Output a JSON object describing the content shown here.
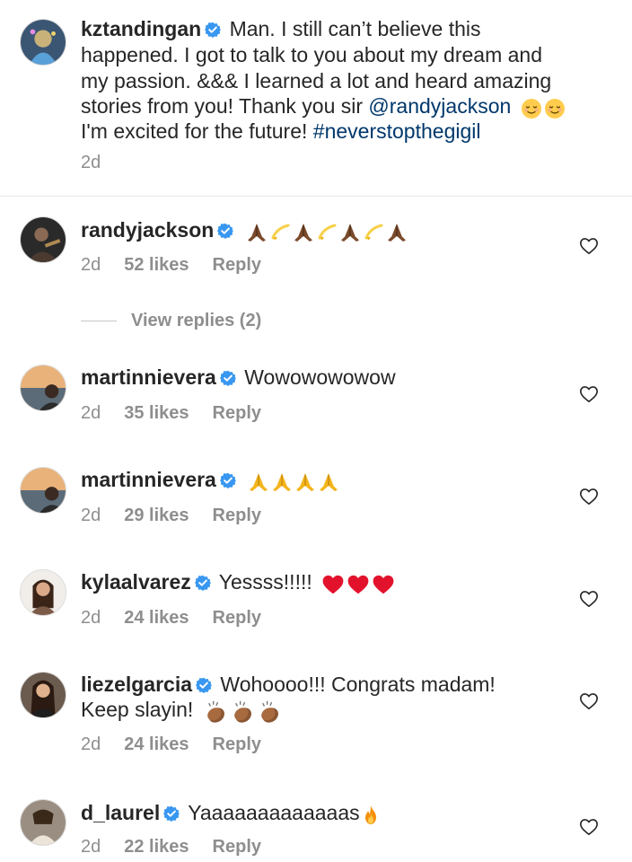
{
  "caption": {
    "username": "kztandingan",
    "lines": [
      "Man. I still can’t believe this",
      "happened. I got to talk to you about my dream and",
      "my passion. &&& I learned a lot and heard amazing",
      "stories from you! Thank you sir"
    ],
    "mention": "@randyjackson",
    "line5": "I'm excited for the future!",
    "hashtag": "#neverstopthegigil",
    "time": "2d",
    "emojis": [
      "relieved-face",
      "relieved-face"
    ]
  },
  "comments": [
    {
      "username": "randyjackson",
      "text": "",
      "emojis": [
        "pray-dark",
        "dizzy",
        "pray-dark",
        "dizzy",
        "pray-dark",
        "dizzy",
        "pray-dark"
      ],
      "time": "2d",
      "likes": "52 likes",
      "reply": "Reply"
    },
    {
      "username": "martinnievera",
      "text": "Wowowowowow",
      "emojis": [],
      "time": "2d",
      "likes": "35 likes",
      "reply": "Reply"
    },
    {
      "username": "martinnievera",
      "text": "",
      "emojis": [
        "pray",
        "pray",
        "pray",
        "pray"
      ],
      "time": "2d",
      "likes": "29 likes",
      "reply": "Reply"
    },
    {
      "username": "kylaalvarez",
      "text": "Yessss!!!!!",
      "emojis": [
        "heart-red",
        "heart-red",
        "heart-red"
      ],
      "time": "2d",
      "likes": "24 likes",
      "reply": "Reply"
    },
    {
      "username": "liezelgarcia",
      "text": "Wohoooo!!! Congrats madam!",
      "text2": "Keep slayin!",
      "emojis": [
        "clap-dark",
        "clap-dark",
        "clap-dark"
      ],
      "time": "2d",
      "likes": "24 likes",
      "reply": "Reply"
    },
    {
      "username": "d_laurel",
      "text": "Yaaaaaaaaaaaaas",
      "emojis": [
        "fire"
      ],
      "time": "2d",
      "likes": "22 likes",
      "reply": "Reply"
    }
  ],
  "view_replies": "View replies (2)",
  "colors": {
    "verified": "#3897f0",
    "link": "#00376b",
    "meta": "#8e8e8e"
  }
}
